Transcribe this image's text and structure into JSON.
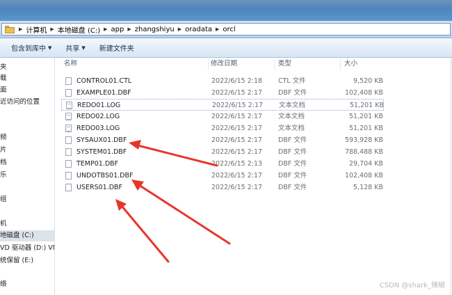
{
  "address_bar": {
    "crumbs": [
      "计算机",
      "本地磁盘 (C:)",
      "app",
      "zhangshiyu",
      "oradata",
      "orcl"
    ]
  },
  "toolbar": {
    "include_in_library": "包含到库中",
    "share": "共享",
    "new_folder": "新建文件夹"
  },
  "nav_pane": {
    "items": [
      "夹",
      "载",
      "面",
      "近访问的位置",
      "频",
      "片",
      "档",
      "乐",
      "组",
      "机",
      "地磁盘 (C:)",
      "VD 驱动器 (D:) VM",
      "统保留 (E:)",
      "络"
    ],
    "selected": "地磁盘 (C:)"
  },
  "columns": {
    "name": "名称",
    "modified": "修改日期",
    "type": "类型",
    "size": "大小"
  },
  "files": [
    {
      "name": "CONTROL01.CTL",
      "modified": "2022/6/15 2:18",
      "type": "CTL 文件",
      "size": "9,520 KB"
    },
    {
      "name": "EXAMPLE01.DBF",
      "modified": "2022/6/15 2:17",
      "type": "DBF 文件",
      "size": "102,408 KB"
    },
    {
      "name": "REDO01.LOG",
      "modified": "2022/6/15 2:17",
      "type": "文本文档",
      "size": "51,201 KB"
    },
    {
      "name": "REDO02.LOG",
      "modified": "2022/6/15 2:17",
      "type": "文本文档",
      "size": "51,201 KB"
    },
    {
      "name": "REDO03.LOG",
      "modified": "2022/6/15 2:17",
      "type": "文本文档",
      "size": "51,201 KB"
    },
    {
      "name": "SYSAUX01.DBF",
      "modified": "2022/6/15 2:17",
      "type": "DBF 文件",
      "size": "593,928 KB"
    },
    {
      "name": "SYSTEM01.DBF",
      "modified": "2022/6/15 2:17",
      "type": "DBF 文件",
      "size": "788,488 KB"
    },
    {
      "name": "TEMP01.DBF",
      "modified": "2022/6/15 2:13",
      "type": "DBF 文件",
      "size": "29,704 KB"
    },
    {
      "name": "UNDOTBS01.DBF",
      "modified": "2022/6/15 2:17",
      "type": "DBF 文件",
      "size": "102,408 KB"
    },
    {
      "name": "USERS01.DBF",
      "modified": "2022/6/15 2:17",
      "type": "DBF 文件",
      "size": "5,128 KB"
    }
  ],
  "focused_file": "REDO01.LOG",
  "colors": {
    "annotation_arrow": "#e8352a",
    "title_bar": "#4e86c1",
    "selection": "#dde3ea"
  },
  "watermark": "CSDN @shark_辣椒"
}
